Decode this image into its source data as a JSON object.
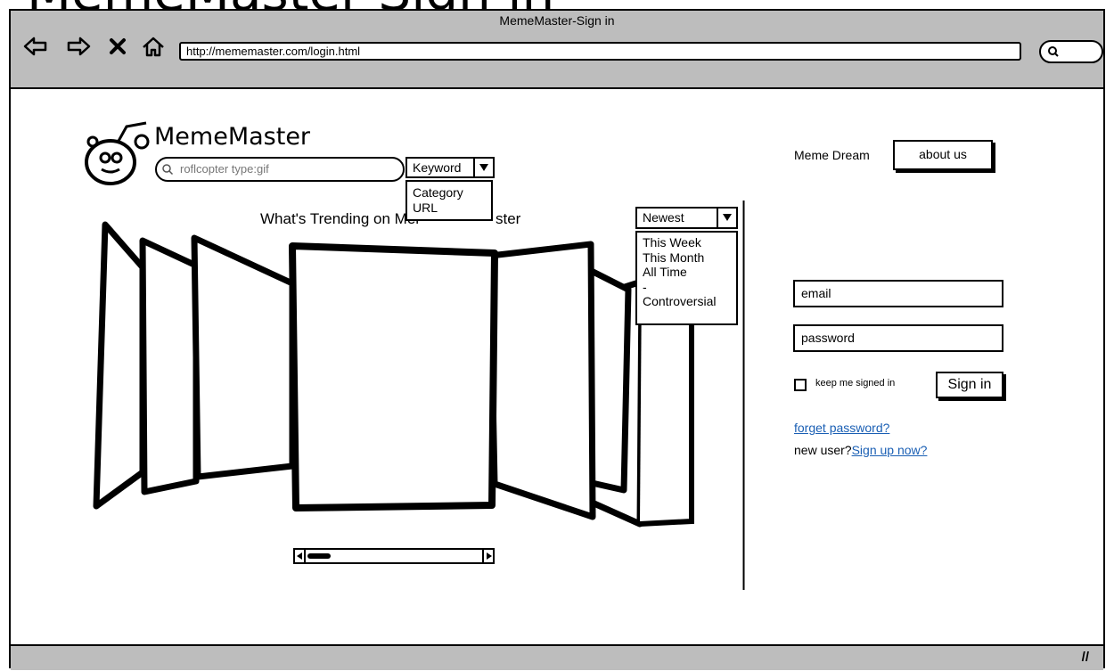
{
  "window": {
    "title": "MemeMaster-Sign in",
    "url": "http://mememaster.com/login.html"
  },
  "browser_nav": {
    "icons": [
      "back-arrow-icon",
      "forward-arrow-icon",
      "stop-x-icon",
      "home-icon"
    ]
  },
  "header": {
    "brand": "MemeMaster",
    "search_placeholder": "roflcopter type:gif",
    "search_type": {
      "selected": "Keyword",
      "options": [
        "Category",
        "URL"
      ]
    }
  },
  "main": {
    "trending_title": "What's Trending on MemeMaster",
    "sort": {
      "selected": "Newest",
      "options": [
        "This Week",
        "This Month",
        "All Time",
        "-",
        "Controversial"
      ]
    }
  },
  "sidebar": {
    "tagline": "Meme Dream",
    "about_label": "about us",
    "email_placeholder": "email",
    "password_placeholder": "password",
    "keep_signed_label": "keep me signed in",
    "keep_signed_checked": false,
    "signin_label": "Sign in",
    "forget_label": "forget password?",
    "new_user_label": "new user?",
    "signup_label": "Sign up now?"
  },
  "top_crop_text": "MemeMaster Sign in"
}
